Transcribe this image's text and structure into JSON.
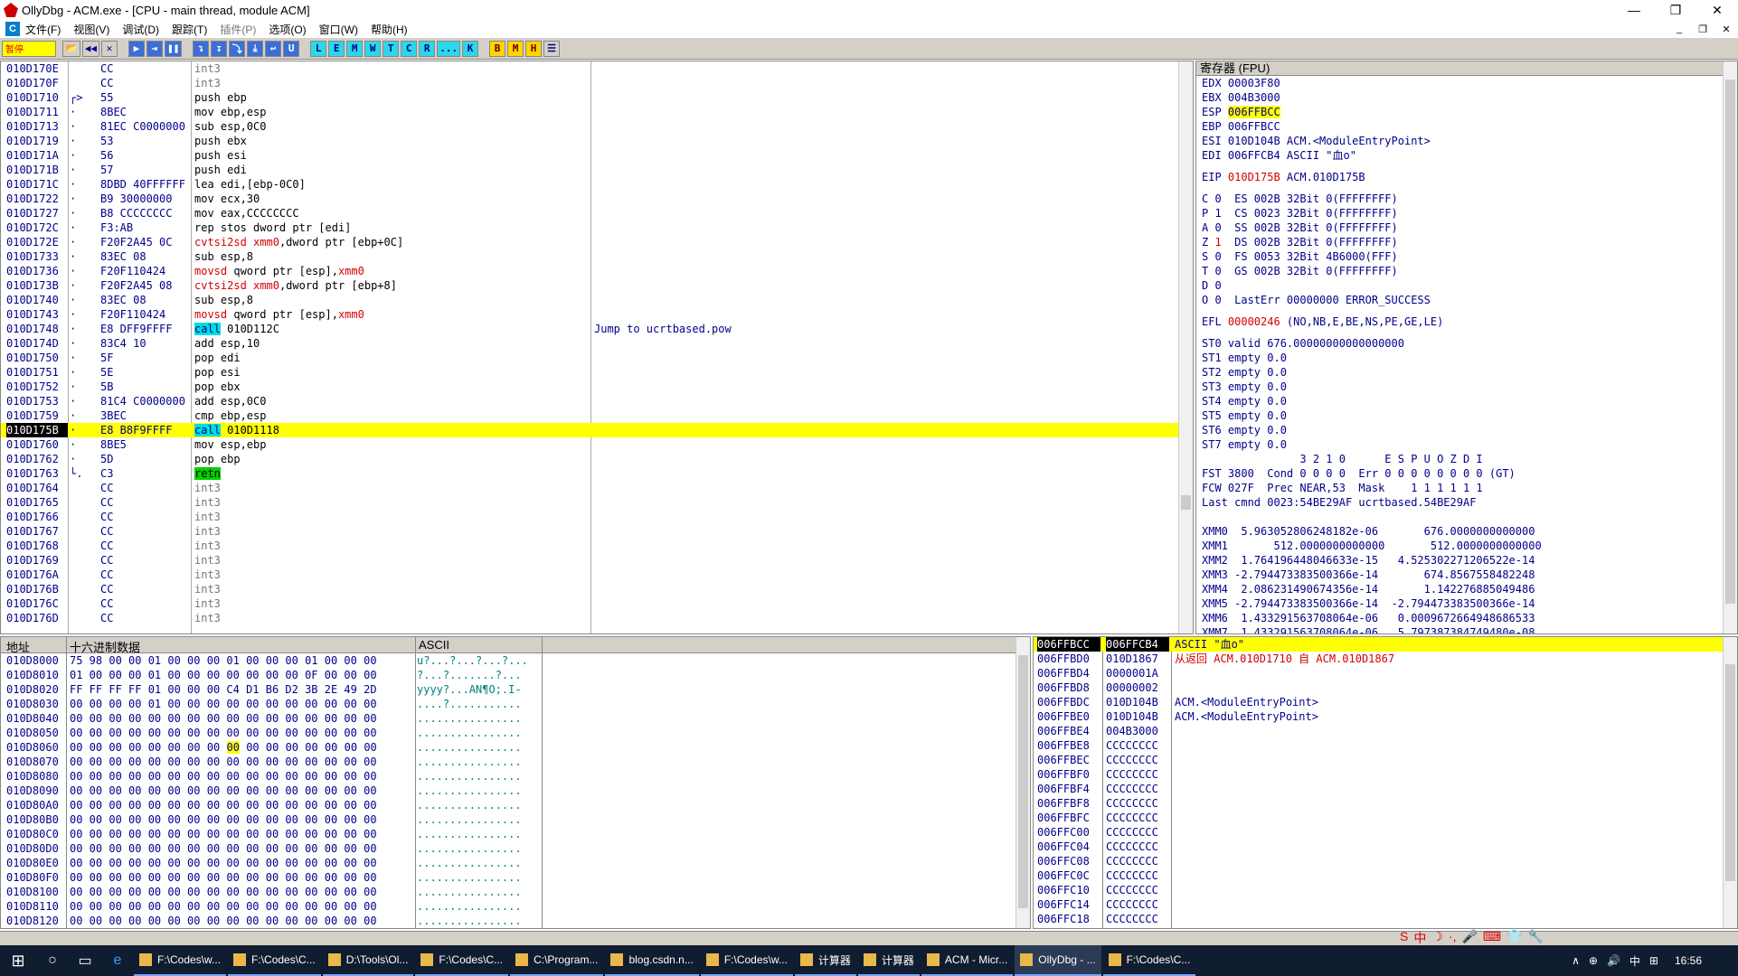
{
  "window": {
    "title": "OllyDbg - ACM.exe - [CPU - main thread, module ACM]",
    "controls": [
      "—",
      "❐",
      "✕"
    ]
  },
  "menu": {
    "c_label": "C",
    "items": [
      {
        "label": "文件(F)",
        "enabled": true
      },
      {
        "label": "视图(V)",
        "enabled": true
      },
      {
        "label": "调试(D)",
        "enabled": true
      },
      {
        "label": "跟踪(T)",
        "enabled": true
      },
      {
        "label": "插件(P)",
        "enabled": false
      },
      {
        "label": "选项(O)",
        "enabled": true
      },
      {
        "label": "窗口(W)",
        "enabled": true
      },
      {
        "label": "帮助(H)",
        "enabled": true
      }
    ],
    "mdi_controls": [
      "_",
      "❐",
      "✕"
    ]
  },
  "toolbar": {
    "status": "暂停",
    "buttons": [
      "📂",
      "◀◀",
      "✕",
      "▶",
      "⇥",
      "❚❚",
      "↴",
      "↧",
      "⤵",
      "⤓",
      "↩",
      "U",
      "L",
      "E",
      "M",
      "W",
      "T",
      "C",
      "R",
      "...",
      "K",
      "B",
      "M",
      "H",
      "☰"
    ]
  },
  "disasm": {
    "rows": [
      {
        "addr": "010D170E",
        "mark": "",
        "hex": "CC",
        "asm": "int3",
        "kind": "grey",
        "cmt": ""
      },
      {
        "addr": "010D170F",
        "mark": "",
        "hex": "CC",
        "asm": "int3",
        "kind": "grey",
        "cmt": ""
      },
      {
        "addr": "010D1710",
        "mark": "┌>",
        "hex": "55",
        "asm": "push ebp",
        "kind": "",
        "cmt": ""
      },
      {
        "addr": "010D1711",
        "mark": "·",
        "hex": "8BEC",
        "asm": "mov ebp,esp",
        "kind": "",
        "cmt": ""
      },
      {
        "addr": "010D1713",
        "mark": "·",
        "hex": "81EC C0000000",
        "asm": "sub esp,0C0",
        "kind": "",
        "cmt": ""
      },
      {
        "addr": "010D1719",
        "mark": "·",
        "hex": "53",
        "asm": "push ebx",
        "kind": "",
        "cmt": ""
      },
      {
        "addr": "010D171A",
        "mark": "·",
        "hex": "56",
        "asm": "push esi",
        "kind": "",
        "cmt": ""
      },
      {
        "addr": "010D171B",
        "mark": "·",
        "hex": "57",
        "asm": "push edi",
        "kind": "",
        "cmt": ""
      },
      {
        "addr": "010D171C",
        "mark": "·",
        "hex": "8DBD 40FFFFFF",
        "asm": "lea edi,[ebp-0C0]",
        "kind": "",
        "cmt": ""
      },
      {
        "addr": "010D1722",
        "mark": "·",
        "hex": "B9 30000000",
        "asm": "mov ecx,30",
        "kind": "",
        "cmt": ""
      },
      {
        "addr": "010D1727",
        "mark": "·",
        "hex": "B8 CCCCCCCC",
        "asm": "mov eax,CCCCCCCC",
        "kind": "",
        "cmt": ""
      },
      {
        "addr": "010D172C",
        "mark": "·",
        "hex": "F3:AB",
        "asm": "rep stos dword ptr [edi]",
        "kind": "",
        "cmt": ""
      },
      {
        "addr": "010D172E",
        "mark": "·",
        "hex": "F20F2A45 0C",
        "asm": "cvtsi2sd xmm0,dword ptr [ebp+0C]",
        "kind": "fp",
        "cmt": ""
      },
      {
        "addr": "010D1733",
        "mark": "·",
        "hex": "83EC 08",
        "asm": "sub esp,8",
        "kind": "",
        "cmt": ""
      },
      {
        "addr": "010D1736",
        "mark": "·",
        "hex": "F20F110424",
        "asm": "movsd qword ptr [esp],xmm0",
        "kind": "fp2",
        "cmt": ""
      },
      {
        "addr": "010D173B",
        "mark": "·",
        "hex": "F20F2A45 08",
        "asm": "cvtsi2sd xmm0,dword ptr [ebp+8]",
        "kind": "fp",
        "cmt": ""
      },
      {
        "addr": "010D1740",
        "mark": "·",
        "hex": "83EC 08",
        "asm": "sub esp,8",
        "kind": "",
        "cmt": ""
      },
      {
        "addr": "010D1743",
        "mark": "·",
        "hex": "F20F110424",
        "asm": "movsd qword ptr [esp],xmm0",
        "kind": "fp2",
        "cmt": ""
      },
      {
        "addr": "010D1748",
        "mark": "·",
        "hex": "E8 DFF9FFFF",
        "asm": "call 010D112C",
        "kind": "call",
        "cmt": "Jump to ucrtbased.pow"
      },
      {
        "addr": "010D174D",
        "mark": "·",
        "hex": "83C4 10",
        "asm": "add esp,10",
        "kind": "",
        "cmt": ""
      },
      {
        "addr": "010D1750",
        "mark": "·",
        "hex": "5F",
        "asm": "pop edi",
        "kind": "",
        "cmt": ""
      },
      {
        "addr": "010D1751",
        "mark": "·",
        "hex": "5E",
        "asm": "pop esi",
        "kind": "",
        "cmt": ""
      },
      {
        "addr": "010D1752",
        "mark": "·",
        "hex": "5B",
        "asm": "pop ebx",
        "kind": "",
        "cmt": ""
      },
      {
        "addr": "010D1753",
        "mark": "·",
        "hex": "81C4 C0000000",
        "asm": "add esp,0C0",
        "kind": "",
        "cmt": ""
      },
      {
        "addr": "010D1759",
        "mark": "·",
        "hex": "3BEC",
        "asm": "cmp ebp,esp",
        "kind": "",
        "cmt": ""
      },
      {
        "addr": "010D175B",
        "mark": "·",
        "hex": "E8 B8F9FFFF",
        "asm": "call 010D1118",
        "kind": "call",
        "cmt": "",
        "hl": true
      },
      {
        "addr": "010D1760",
        "mark": "·",
        "hex": "8BE5",
        "asm": "mov esp,ebp",
        "kind": "",
        "cmt": ""
      },
      {
        "addr": "010D1762",
        "mark": "·",
        "hex": "5D",
        "asm": "pop ebp",
        "kind": "",
        "cmt": ""
      },
      {
        "addr": "010D1763",
        "mark": "└.",
        "hex": "C3",
        "asm": "retn",
        "kind": "ret",
        "cmt": ""
      },
      {
        "addr": "010D1764",
        "mark": "",
        "hex": "CC",
        "asm": "int3",
        "kind": "grey",
        "cmt": ""
      },
      {
        "addr": "010D1765",
        "mark": "",
        "hex": "CC",
        "asm": "int3",
        "kind": "grey",
        "cmt": ""
      },
      {
        "addr": "010D1766",
        "mark": "",
        "hex": "CC",
        "asm": "int3",
        "kind": "grey",
        "cmt": ""
      },
      {
        "addr": "010D1767",
        "mark": "",
        "hex": "CC",
        "asm": "int3",
        "kind": "grey",
        "cmt": ""
      },
      {
        "addr": "010D1768",
        "mark": "",
        "hex": "CC",
        "asm": "int3",
        "kind": "grey",
        "cmt": ""
      },
      {
        "addr": "010D1769",
        "mark": "",
        "hex": "CC",
        "asm": "int3",
        "kind": "grey",
        "cmt": ""
      },
      {
        "addr": "010D176A",
        "mark": "",
        "hex": "CC",
        "asm": "int3",
        "kind": "grey",
        "cmt": ""
      },
      {
        "addr": "010D176B",
        "mark": "",
        "hex": "CC",
        "asm": "int3",
        "kind": "grey",
        "cmt": ""
      },
      {
        "addr": "010D176C",
        "mark": "",
        "hex": "CC",
        "asm": "int3",
        "kind": "grey",
        "cmt": ""
      },
      {
        "addr": "010D176D",
        "mark": "",
        "hex": "CC",
        "asm": "int3",
        "kind": "grey",
        "cmt": ""
      }
    ]
  },
  "registers": {
    "header": "寄存器 (FPU)",
    "lines": [
      {
        "t": "EDX 00003F80"
      },
      {
        "t": "EBX 004B3000"
      },
      {
        "pre": "ESP ",
        "yl": "006FFBCC",
        "post": ""
      },
      {
        "t": "EBP 006FFBCC"
      },
      {
        "t": "ESI 010D104B ACM.<ModuleEntryPoint>"
      },
      {
        "t": "EDI 006FFCB4 ASCII \"血o\""
      },
      {
        "gap": true
      },
      {
        "pre": "EIP ",
        "red": "010D175B",
        "post": " ACM.010D175B"
      },
      {
        "gap": true
      },
      {
        "t": "C 0  ES 002B 32Bit 0(FFFFFFFF)"
      },
      {
        "t": "P 1  CS 0023 32Bit 0(FFFFFFFF)"
      },
      {
        "t": "A 0  SS 002B 32Bit 0(FFFFFFFF)"
      },
      {
        "pre": "Z ",
        "red": "1",
        "post": "  DS 002B 32Bit 0(FFFFFFFF)"
      },
      {
        "t": "S 0  FS 0053 32Bit 4B6000(FFF)"
      },
      {
        "t": "T 0  GS 002B 32Bit 0(FFFFFFFF)"
      },
      {
        "t": "D 0"
      },
      {
        "t": "O 0  LastErr 00000000 ERROR_SUCCESS"
      },
      {
        "gap": true
      },
      {
        "pre": "EFL ",
        "red": "00000246",
        "post": " (NO,NB,E,BE,NS,PE,GE,LE)"
      },
      {
        "gap": true
      },
      {
        "t": "ST0 valid 676.00000000000000000"
      },
      {
        "t": "ST1 empty 0.0"
      },
      {
        "t": "ST2 empty 0.0"
      },
      {
        "t": "ST3 empty 0.0"
      },
      {
        "t": "ST4 empty 0.0"
      },
      {
        "t": "ST5 empty 0.0"
      },
      {
        "t": "ST6 empty 0.0"
      },
      {
        "t": "ST7 empty 0.0"
      },
      {
        "t": "               3 2 1 0      E S P U O Z D I"
      },
      {
        "t": "FST 3800  Cond 0 0 0 0  Err 0 0 0 0 0 0 0 0 (GT)"
      },
      {
        "t": "FCW 027F  Prec NEAR,53  Mask    1 1 1 1 1 1"
      },
      {
        "t": "Last cmnd 0023:54BE29AF ucrtbased.54BE29AF"
      },
      {
        "gap": true
      },
      {
        "gap": true
      },
      {
        "t": "XMM0  5.963052806248182e-06       676.0000000000000"
      },
      {
        "t": "XMM1       512.0000000000000       512.0000000000000"
      },
      {
        "t": "XMM2  1.764196448046633e-15   4.525302271206522e-14"
      },
      {
        "t": "XMM3 -2.794473383500366e-14       674.8567558482248"
      },
      {
        "t": "XMM4  2.086231490674356e-14       1.142276885049486"
      },
      {
        "t": "XMM5 -2.794473383500366e-14  -2.794473383500366e-14"
      },
      {
        "t": "XMM6  1.433291563708064e-06   0.0009672664948686533"
      },
      {
        "t": "XMM7  1.433291563708064e-06   5.797387384749480e-08"
      }
    ]
  },
  "dump": {
    "headers": {
      "addr": "地址",
      "hex": "十六进制数据",
      "ascii": "ASCII"
    },
    "rows": [
      {
        "addr": "010D8000",
        "hex": "75 98 00 00 01 00 00 00 01 00 00 00 01 00 00 00",
        "ascii": "u?...?...?...?..."
      },
      {
        "addr": "010D8010",
        "hex": "01 00 00 00 01 00 00 00 00 00 00 00 0F 00 00 00",
        "ascii": "?...?.......?..."
      },
      {
        "addr": "010D8020",
        "hex": "FF FF FF FF 01 00 00 00 C4 D1 B6 D2 3B 2E 49 2D",
        "ascii": "yyyy?...AN¶O;.I-"
      },
      {
        "addr": "010D8030",
        "hex": "00 00 00 00 01 00 00 00 00 00 00 00 00 00 00 00",
        "ascii": "....?..........."
      },
      {
        "addr": "010D8040",
        "hex": "00 00 00 00 00 00 00 00 00 00 00 00 00 00 00 00",
        "ascii": "................"
      },
      {
        "addr": "010D8050",
        "hex": "00 00 00 00 00 00 00 00 00 00 00 00 00 00 00 00",
        "ascii": "................"
      },
      {
        "addr": "010D8060",
        "hex": "00 00 00 00 00 00 00 00 00 00 00 00 00 00 00 00",
        "ascii": "................",
        "hlIndex": 8
      },
      {
        "addr": "010D8070",
        "hex": "00 00 00 00 00 00 00 00 00 00 00 00 00 00 00 00",
        "ascii": "................"
      },
      {
        "addr": "010D8080",
        "hex": "00 00 00 00 00 00 00 00 00 00 00 00 00 00 00 00",
        "ascii": "................"
      },
      {
        "addr": "010D8090",
        "hex": "00 00 00 00 00 00 00 00 00 00 00 00 00 00 00 00",
        "ascii": "................"
      },
      {
        "addr": "010D80A0",
        "hex": "00 00 00 00 00 00 00 00 00 00 00 00 00 00 00 00",
        "ascii": "................"
      },
      {
        "addr": "010D80B0",
        "hex": "00 00 00 00 00 00 00 00 00 00 00 00 00 00 00 00",
        "ascii": "................"
      },
      {
        "addr": "010D80C0",
        "hex": "00 00 00 00 00 00 00 00 00 00 00 00 00 00 00 00",
        "ascii": "................"
      },
      {
        "addr": "010D80D0",
        "hex": "00 00 00 00 00 00 00 00 00 00 00 00 00 00 00 00",
        "ascii": "................"
      },
      {
        "addr": "010D80E0",
        "hex": "00 00 00 00 00 00 00 00 00 00 00 00 00 00 00 00",
        "ascii": "................"
      },
      {
        "addr": "010D80F0",
        "hex": "00 00 00 00 00 00 00 00 00 00 00 00 00 00 00 00",
        "ascii": "................"
      },
      {
        "addr": "010D8100",
        "hex": "00 00 00 00 00 00 00 00 00 00 00 00 00 00 00 00",
        "ascii": "................"
      },
      {
        "addr": "010D8110",
        "hex": "00 00 00 00 00 00 00 00 00 00 00 00 00 00 00 00",
        "ascii": "................"
      },
      {
        "addr": "010D8120",
        "hex": "00 00 00 00 00 00 00 00 00 00 00 00 00 00 00 00",
        "ascii": "................"
      }
    ]
  },
  "stack": {
    "rows": [
      {
        "a": "006FFBCC",
        "v": "006FFCB4",
        "c": "ASCII \"血o\"",
        "top": true
      },
      {
        "a": "006FFBD0",
        "v": "010D1867",
        "red": "从返回 ACM.010D1710 自 ACM.010D1867"
      },
      {
        "a": "006FFBD4",
        "v": "0000001A",
        "c": ""
      },
      {
        "a": "006FFBD8",
        "v": "00000002",
        "c": ""
      },
      {
        "a": "006FFBDC",
        "v": "010D104B",
        "c": "ACM.<ModuleEntryPoint>"
      },
      {
        "a": "006FFBE0",
        "v": "010D104B",
        "c": "ACM.<ModuleEntryPoint>"
      },
      {
        "a": "006FFBE4",
        "v": "004B3000",
        "c": ""
      },
      {
        "a": "006FFBE8",
        "v": "CCCCCCCC",
        "c": ""
      },
      {
        "a": "006FFBEC",
        "v": "CCCCCCCC",
        "c": ""
      },
      {
        "a": "006FFBF0",
        "v": "CCCCCCCC",
        "c": ""
      },
      {
        "a": "006FFBF4",
        "v": "CCCCCCCC",
        "c": ""
      },
      {
        "a": "006FFBF8",
        "v": "CCCCCCCC",
        "c": ""
      },
      {
        "a": "006FFBFC",
        "v": "CCCCCCCC",
        "c": ""
      },
      {
        "a": "006FFC00",
        "v": "CCCCCCCC",
        "c": ""
      },
      {
        "a": "006FFC04",
        "v": "CCCCCCCC",
        "c": ""
      },
      {
        "a": "006FFC08",
        "v": "CCCCCCCC",
        "c": ""
      },
      {
        "a": "006FFC0C",
        "v": "CCCCCCCC",
        "c": ""
      },
      {
        "a": "006FFC10",
        "v": "CCCCCCCC",
        "c": ""
      },
      {
        "a": "006FFC14",
        "v": "CCCCCCCC",
        "c": ""
      },
      {
        "a": "006FFC18",
        "v": "CCCCCCCC",
        "c": ""
      }
    ]
  },
  "ime": [
    "S",
    "中",
    "☽",
    "·,",
    "🎤",
    "⌨",
    "👕",
    "🔧"
  ],
  "taskbar": {
    "tasks": [
      {
        "label": "F:\\Codes\\w..."
      },
      {
        "label": "F:\\Codes\\C..."
      },
      {
        "label": "D:\\Tools\\Ol..."
      },
      {
        "label": "F:\\Codes\\C..."
      },
      {
        "label": "C:\\Program..."
      },
      {
        "label": "blog.csdn.n..."
      },
      {
        "label": "F:\\Codes\\w..."
      },
      {
        "label": "计算器"
      },
      {
        "label": "计算器"
      },
      {
        "label": "ACM - Micr..."
      },
      {
        "label": "OllyDbg - ...",
        "active": true
      },
      {
        "label": "F:\\Codes\\C..."
      }
    ],
    "tray": [
      "∧",
      "⊕",
      "🔊",
      "中",
      "⊞"
    ],
    "time": "16:56"
  }
}
